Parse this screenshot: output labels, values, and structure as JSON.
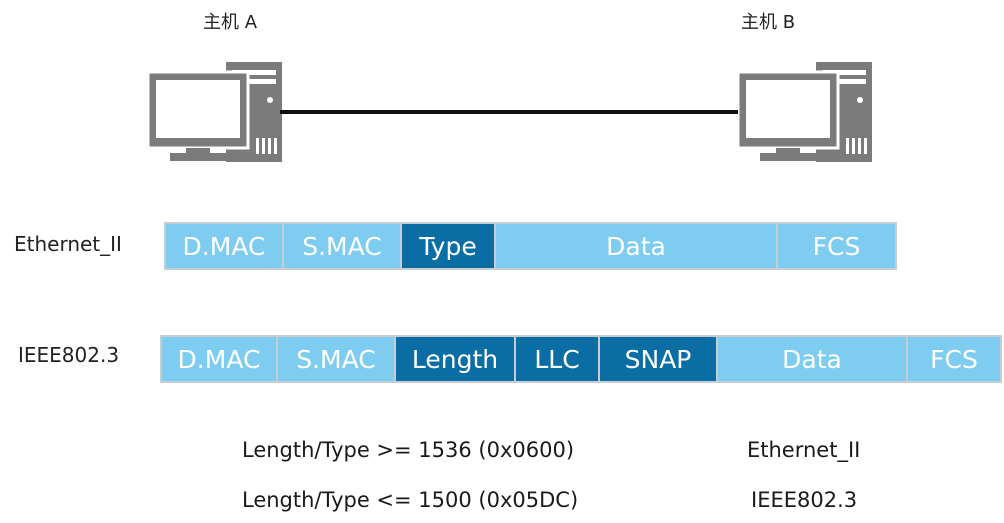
{
  "hosts": {
    "a_label": "主机 A",
    "b_label": "主机 B"
  },
  "ethernet_ii": {
    "label": "Ethernet_II",
    "fields": [
      {
        "text": "D.MAC",
        "style": "light"
      },
      {
        "text": "S.MAC",
        "style": "light"
      },
      {
        "text": "Type",
        "style": "dark"
      },
      {
        "text": "Data",
        "style": "light"
      },
      {
        "text": "FCS",
        "style": "light"
      }
    ]
  },
  "ieee8023": {
    "label": "IEEE802.3",
    "fields": [
      {
        "text": "D.MAC",
        "style": "light"
      },
      {
        "text": "S.MAC",
        "style": "light"
      },
      {
        "text": "Length",
        "style": "dark"
      },
      {
        "text": "LLC",
        "style": "dark"
      },
      {
        "text": "SNAP",
        "style": "dark"
      },
      {
        "text": "Data",
        "style": "light"
      },
      {
        "text": "FCS",
        "style": "light"
      }
    ]
  },
  "rules": [
    {
      "condition": "Length/Type >= 1536 (0x0600)",
      "result": "Ethernet_II"
    },
    {
      "condition": "Length/Type <= 1500 (0x05DC)",
      "result": "IEEE802.3"
    }
  ],
  "colors": {
    "light_field": "#7ecdf0",
    "dark_field": "#0a6ea5",
    "computer_gray": "#7b7b7b"
  },
  "icons": [
    "desktop-computer-icon"
  ]
}
